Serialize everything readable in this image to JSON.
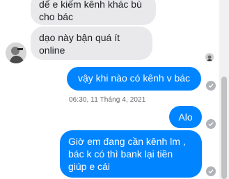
{
  "messages": [
    {
      "sender": "them",
      "text": "dể e kiếm kênh khác bù cho bác"
    },
    {
      "sender": "them",
      "text": "dạo này bận quá ít online"
    },
    {
      "sender": "me",
      "text": "vậy khi nào có kênh v bác"
    },
    {
      "sender": "me",
      "text": "Alo"
    },
    {
      "sender": "me",
      "text": "Giờ em đang cần kênh lm , bác k có thì bank lại tiền giúp e cái"
    }
  ],
  "timestamp": "06:30, 11 Tháng 4, 2021",
  "colors": {
    "outgoing_bubble": "#0084ff",
    "incoming_bubble": "#e9e9eb",
    "seen_icon": "#b0b3b8"
  }
}
